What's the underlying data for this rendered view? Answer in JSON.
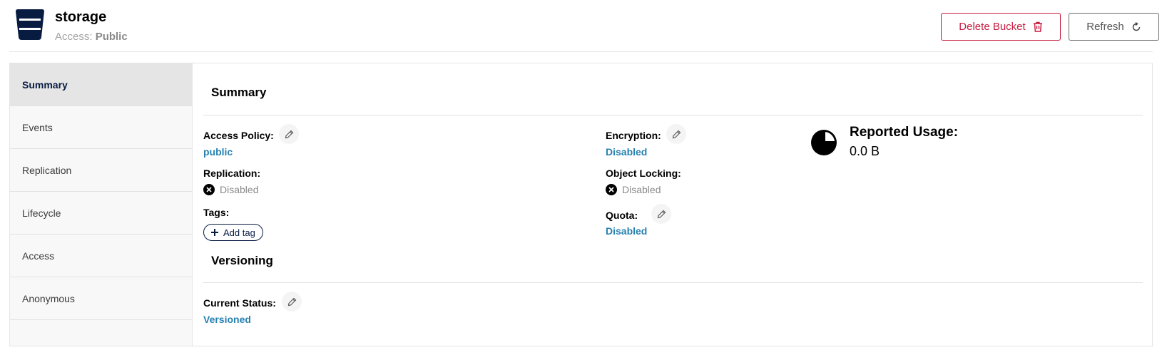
{
  "header": {
    "bucket_name": "storage",
    "access_prefix": "Access:",
    "access_value": "Public",
    "delete_label": "Delete Bucket",
    "refresh_label": "Refresh"
  },
  "sidebar": {
    "items": [
      {
        "label": "Summary",
        "active": true
      },
      {
        "label": "Events"
      },
      {
        "label": "Replication"
      },
      {
        "label": "Lifecycle"
      },
      {
        "label": "Access"
      },
      {
        "label": "Anonymous"
      }
    ]
  },
  "summary": {
    "title": "Summary",
    "access_policy_label": "Access Policy:",
    "access_policy_value": "public",
    "replication_label": "Replication:",
    "replication_value": "Disabled",
    "tags_label": "Tags:",
    "add_tag_label": "Add tag",
    "encryption_label": "Encryption:",
    "encryption_value": "Disabled",
    "object_locking_label": "Object Locking:",
    "object_locking_value": "Disabled",
    "quota_label": "Quota:",
    "quota_value": "Disabled",
    "reported_usage_label": "Reported Usage:",
    "reported_usage_value": "0.0 B"
  },
  "versioning": {
    "title": "Versioning",
    "current_status_label": "Current Status:",
    "current_status_value": "Versioned"
  },
  "colors": {
    "accent_link": "#2781b0",
    "danger": "#c51b3f",
    "navy": "#081c42"
  },
  "icons": [
    "bucket-icon",
    "trash-icon",
    "refresh-icon",
    "pencil-icon",
    "x-circle-icon",
    "plus-icon",
    "pie-chart-icon"
  ]
}
